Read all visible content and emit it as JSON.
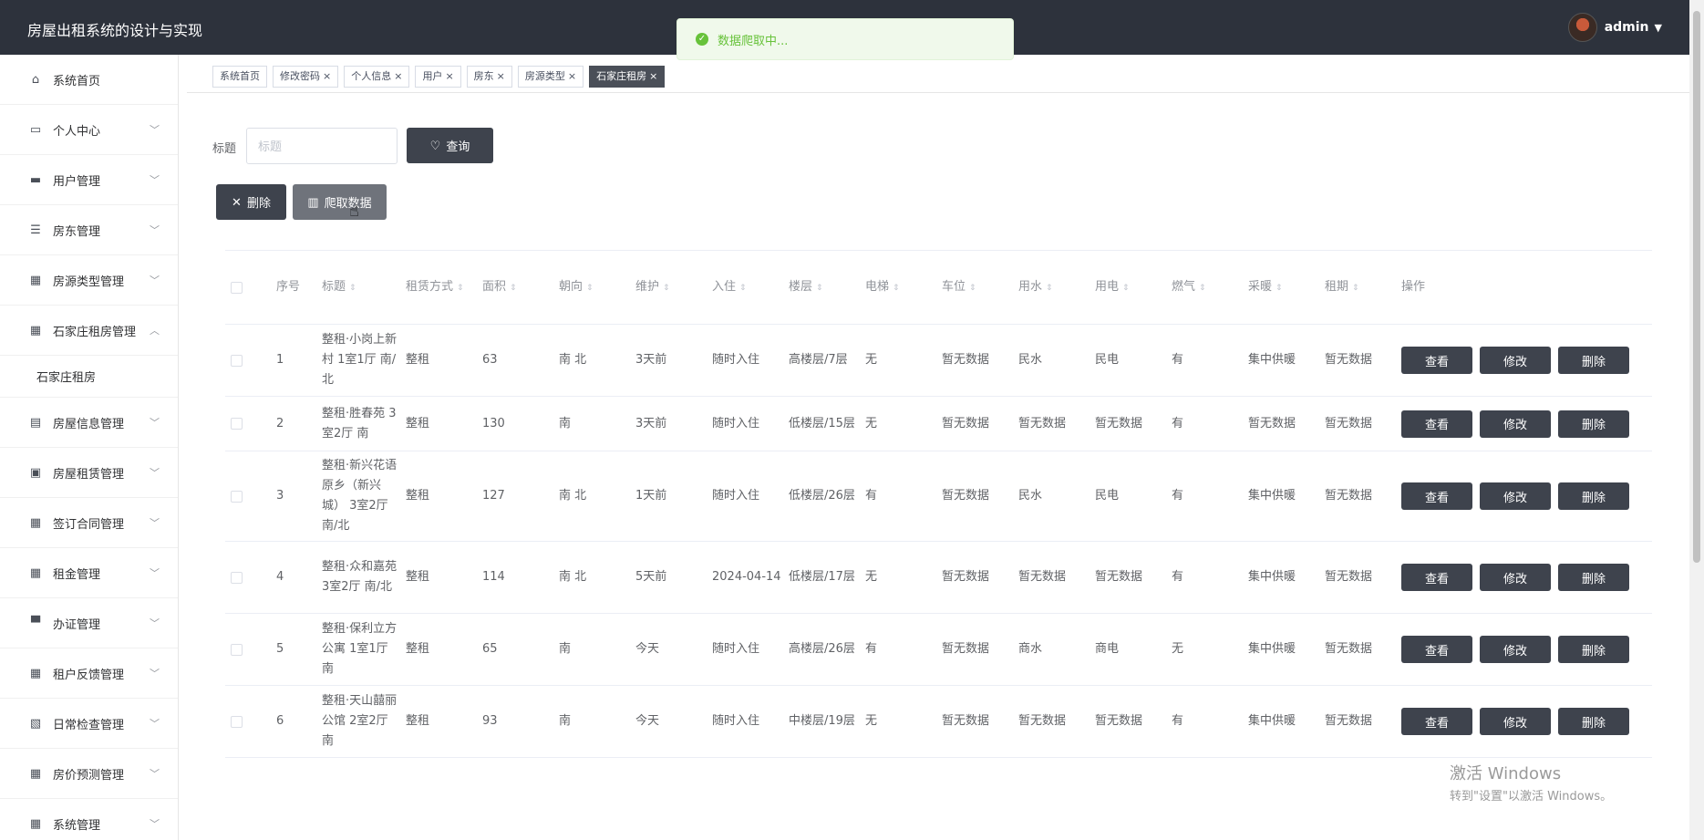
{
  "app": {
    "title": "房屋出租系统的设计与实现",
    "user": "admin"
  },
  "toast": {
    "text": "数据爬取中..."
  },
  "sidebar": {
    "items": [
      {
        "label": "系统首页",
        "icon": "home-icon",
        "glyph": "⌂"
      },
      {
        "label": "个人中心",
        "icon": "card-icon",
        "glyph": "▭",
        "chevron": "﹀"
      },
      {
        "label": "用户管理",
        "icon": "ticket-icon",
        "glyph": "▬",
        "chevron": "﹀"
      },
      {
        "label": "房东管理",
        "icon": "list-icon",
        "glyph": "☰",
        "chevron": "﹀"
      },
      {
        "label": "房源类型管理",
        "icon": "grid-icon",
        "glyph": "▦",
        "chevron": "﹀"
      },
      {
        "label": "石家庄租房管理",
        "icon": "grid-icon",
        "glyph": "▦",
        "chevron": "︿"
      },
      {
        "label": "石家庄租房",
        "sub": true
      },
      {
        "label": "房屋信息管理",
        "icon": "briefcase-icon",
        "glyph": "▤",
        "chevron": "﹀"
      },
      {
        "label": "房屋租赁管理",
        "icon": "chat-icon",
        "glyph": "▣",
        "chevron": "﹀"
      },
      {
        "label": "签订合同管理",
        "icon": "grid-icon",
        "glyph": "▦",
        "chevron": "﹀"
      },
      {
        "label": "租金管理",
        "icon": "grid-icon",
        "glyph": "▦",
        "chevron": "﹀"
      },
      {
        "label": "办证管理",
        "icon": "printer-icon",
        "glyph": "▀",
        "chevron": "﹀"
      },
      {
        "label": "租户反馈管理",
        "icon": "grid-icon",
        "glyph": "▦",
        "chevron": "﹀"
      },
      {
        "label": "日常检查管理",
        "icon": "clipboard-icon",
        "glyph": "▧",
        "chevron": "﹀"
      },
      {
        "label": "房价预测管理",
        "icon": "grid-icon",
        "glyph": "▦",
        "chevron": "﹀"
      },
      {
        "label": "系统管理",
        "icon": "grid-icon",
        "glyph": "▦",
        "chevron": "﹀"
      }
    ]
  },
  "tabs": [
    {
      "label": "系统首页",
      "closable": false
    },
    {
      "label": "修改密码",
      "closable": true
    },
    {
      "label": "个人信息",
      "closable": true
    },
    {
      "label": "用户",
      "closable": true
    },
    {
      "label": "房东",
      "closable": true
    },
    {
      "label": "房源类型",
      "closable": true
    },
    {
      "label": "石家庄租房",
      "closable": true,
      "active": true
    }
  ],
  "filter": {
    "label": "标题",
    "placeholder": "标题",
    "query_label": "查询"
  },
  "actions": {
    "delete_label": "删除",
    "crawl_label": "爬取数据"
  },
  "table": {
    "headers": [
      "序号",
      "标题",
      "租赁方式",
      "面积",
      "朝向",
      "维护",
      "入住",
      "楼层",
      "电梯",
      "车位",
      "用水",
      "用电",
      "燃气",
      "采暖",
      "租期",
      "操作"
    ],
    "op_labels": {
      "view": "查看",
      "edit": "修改",
      "delete": "删除"
    },
    "rows": [
      [
        "1",
        "整租·小岗上新村 1室1厅 南/北",
        "整租",
        "63",
        "南 北",
        "3天前",
        "随时入住",
        "高楼层/7层",
        "无",
        "暂无数据",
        "民水",
        "民电",
        "有",
        "集中供暖",
        "暂无数据"
      ],
      [
        "2",
        "整租·胜春苑 3室2厅 南",
        "整租",
        "130",
        "南",
        "3天前",
        "随时入住",
        "低楼层/15层",
        "无",
        "暂无数据",
        "暂无数据",
        "暂无数据",
        "有",
        "暂无数据",
        "暂无数据"
      ],
      [
        "3",
        "整租·新兴花语原乡（新兴城） 3室2厅 南/北",
        "整租",
        "127",
        "南 北",
        "1天前",
        "随时入住",
        "低楼层/26层",
        "有",
        "暂无数据",
        "民水",
        "民电",
        "有",
        "集中供暖",
        "暂无数据"
      ],
      [
        "4",
        "整租·众和嘉苑 3室2厅 南/北",
        "整租",
        "114",
        "南 北",
        "5天前",
        "2024-04-14",
        "低楼层/17层",
        "无",
        "暂无数据",
        "暂无数据",
        "暂无数据",
        "有",
        "集中供暖",
        "暂无数据"
      ],
      [
        "5",
        "整租·保利立方公寓 1室1厅 南",
        "整租",
        "65",
        "南",
        "今天",
        "随时入住",
        "高楼层/26层",
        "有",
        "暂无数据",
        "商水",
        "商电",
        "无",
        "集中供暖",
        "暂无数据"
      ],
      [
        "6",
        "整租·天山囍丽公馆 2室2厅 南",
        "整租",
        "93",
        "南",
        "今天",
        "随时入住",
        "中楼层/19层",
        "无",
        "暂无数据",
        "暂无数据",
        "暂无数据",
        "有",
        "集中供暖",
        "暂无数据"
      ]
    ]
  },
  "watermark": {
    "line1": "激活 Windows",
    "line2": "转到\"设置\"以激活 Windows。"
  }
}
